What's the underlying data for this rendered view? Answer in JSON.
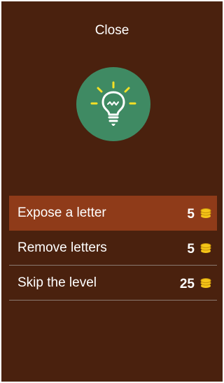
{
  "dialog": {
    "close_label": "Close",
    "hint_icon": "lightbulb-icon",
    "colors": {
      "background": "#4a210e",
      "selected_row": "#8f3b19",
      "icon_circle": "#3f8a63",
      "coin": "#f5c518"
    }
  },
  "options": [
    {
      "label": "Expose a letter",
      "cost": "5",
      "selected": true
    },
    {
      "label": "Remove letters",
      "cost": "5",
      "selected": false
    },
    {
      "label": "Skip the level",
      "cost": "25",
      "selected": false
    }
  ],
  "coin_icon": "coins-icon"
}
